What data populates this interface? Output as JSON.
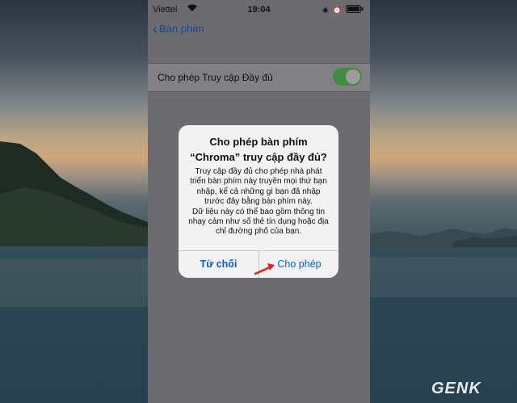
{
  "status_bar": {
    "carrier": "Viettel",
    "time": "19:04"
  },
  "nav": {
    "back_label": "Bàn phím"
  },
  "setting": {
    "label": "Cho phép Truy cập Đầy đủ",
    "enabled": true
  },
  "dialog": {
    "title_line1": "Cho phép bàn phím",
    "title_line2": "“Chroma” truy cập đầy đủ?",
    "message_lines": [
      "Truy cập đầy đủ cho phép nhà phát",
      "triển bàn phím này truyền mọi thứ bạn",
      "nhập, kể cả những gì bạn đã nhập",
      "trước đây bằng bàn phím này.",
      "Dữ liệu này có thể bao gồm thông tin",
      "nhạy cảm như số thẻ tín dụng hoặc địa",
      "chỉ đường phố của bạn."
    ],
    "deny_label": "Từ chối",
    "allow_label": "Cho phép"
  },
  "watermark": "GENK",
  "colors": {
    "link": "#0a5bc4",
    "toggle_on": "#3f8c45",
    "annotation_arrow": "#e02020"
  }
}
